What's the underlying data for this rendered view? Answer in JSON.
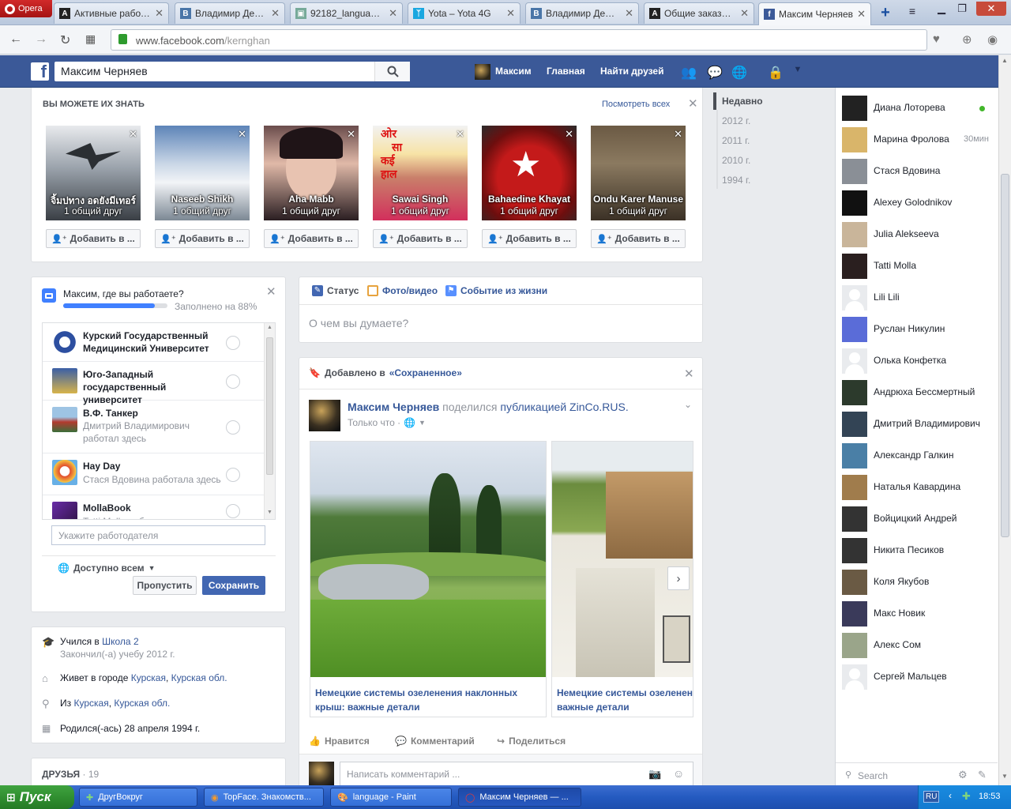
{
  "browser": {
    "opera_label": "Opera",
    "tabs": [
      {
        "title": "Активные работы",
        "favicon": "A",
        "color": "#222"
      },
      {
        "title": "Владимир Демченко",
        "favicon": "B",
        "color": "#4a76a8"
      },
      {
        "title": "92182_language - S",
        "favicon": "▣",
        "color": "#7a9"
      },
      {
        "title": "Yota – Yota 4G",
        "favicon": "ᛉ",
        "color": "#19a7e0"
      },
      {
        "title": "Владимир Демченко",
        "favicon": "B",
        "color": "#4a76a8"
      },
      {
        "title": "Общие заказы Пер",
        "favicon": "A",
        "color": "#222"
      },
      {
        "title": "Максим Черняев",
        "favicon": "f",
        "color": "#3b5998"
      }
    ],
    "url_domain": "www.facebook.com",
    "url_path": "/kernghan"
  },
  "header": {
    "search_value": "Максим Черняев",
    "user_name": "Максим",
    "home": "Главная",
    "find_friends": "Найти друзей"
  },
  "pymk": {
    "title": "ВЫ МОЖЕТЕ ИХ ЗНАТЬ",
    "see_all": "Посмотреть всех",
    "people": [
      {
        "name": "จิ้มปทาง อดยังมีเทอร์",
        "mutual": "1 общий друг",
        "add": "Добавить в ..."
      },
      {
        "name": "Naseeb Shikh",
        "mutual": "1 общий друг",
        "add": "Добавить в ..."
      },
      {
        "name": "Aha Mabb",
        "mutual": "1 общий друг",
        "add": "Добавить в ..."
      },
      {
        "name": "Sawai Singh",
        "mutual": "1 общий друг",
        "add": "Добавить в ..."
      },
      {
        "name": "Bahaedine Khayat",
        "mutual": "1 общий друг",
        "add": "Добавить в ..."
      },
      {
        "name": "Ondu Karer Manuse",
        "mutual": "1 общий друг",
        "add": "Добавить в ..."
      }
    ],
    "poster_text": [
      "ओर",
      "सा",
      "कई",
      "हाल"
    ]
  },
  "timeline": {
    "items": [
      "Недавно",
      "2012 г.",
      "2011 г.",
      "2010 г.",
      "1994 г."
    ]
  },
  "work": {
    "question": "Максим, где вы работаете?",
    "progress_label": "Заполнено на 88%",
    "progress_value": 0.88,
    "list": [
      {
        "title": "Курский Государственный Медицинский Университет",
        "sub": ""
      },
      {
        "title": "Юго-Западный государственный университет",
        "sub": ""
      },
      {
        "title": "В.Ф. Танкер",
        "sub": "Дмитрий Владимирович работал здесь"
      },
      {
        "title": "Hay Day",
        "sub": "Стася Вдовина работала здесь"
      },
      {
        "title": "MollaBook",
        "sub": "Tatti Molla работала здесь"
      }
    ],
    "input_placeholder": "Укажите работодателя",
    "privacy": "Доступно всем",
    "skip": "Пропустить",
    "save": "Сохранить"
  },
  "about": {
    "studied_prefix": "Учился в",
    "studied_link": "Школа 2",
    "studied_sub": "Закончил(-а) учебу 2012 г.",
    "lives_prefix": "Живет в городе",
    "lives_city": "Курская",
    "lives_region": "Курская обл.",
    "from_prefix": "Из",
    "from_city": "Курская",
    "from_region": "Курская обл.",
    "born": "Родился(-ась) 28 апреля 1994 г.",
    "comma": ","
  },
  "friends": {
    "label": "ДРУЗЬЯ",
    "count": "· 19"
  },
  "composer": {
    "status": "Статус",
    "photo": "Фото/видео",
    "life_event": "Событие из жизни",
    "placeholder": "О чем вы думаете?"
  },
  "post": {
    "saved_prefix": "Добавлено в",
    "saved_link": "«Сохраненное»",
    "author": "Максим Черняев",
    "action": "поделился",
    "publication": "публикацией",
    "page": "ZinCo.RUS.",
    "time": "Только что ·",
    "links": [
      {
        "title": "Немецкие системы озеленения наклонных крыш: важные детали"
      },
      {
        "title": "Немецкие системы озеленения наклонных крыш: важные детали"
      }
    ],
    "like": "Нравится",
    "comment": "Комментарий",
    "share": "Поделиться",
    "comment_placeholder": "Написать комментарий ..."
  },
  "chat": {
    "contacts": [
      {
        "name": "Диана Лоторева",
        "status": "online"
      },
      {
        "name": "Марина Фролова",
        "status": "30мин"
      },
      {
        "name": "Стася Вдовина",
        "status": ""
      },
      {
        "name": "Alexey Golodnikov",
        "status": ""
      },
      {
        "name": "Julia Alekseeva",
        "status": ""
      },
      {
        "name": "Tatti Molla",
        "status": ""
      },
      {
        "name": "Lili Lili",
        "status": ""
      },
      {
        "name": "Руслан Никулин",
        "status": ""
      },
      {
        "name": "Олька Конфетка",
        "status": ""
      },
      {
        "name": "Андрюха Бессмертный",
        "status": ""
      },
      {
        "name": "Дмитрий Владимирович",
        "status": ""
      },
      {
        "name": "Александр Галкин",
        "status": ""
      },
      {
        "name": "Наталья Кавардина",
        "status": ""
      },
      {
        "name": "Войцицкий Андрей",
        "status": ""
      },
      {
        "name": "Никита Песиков",
        "status": ""
      },
      {
        "name": "Коля Якубов",
        "status": ""
      },
      {
        "name": "Макс Новик",
        "status": ""
      },
      {
        "name": "Алекс Сом",
        "status": ""
      },
      {
        "name": "Сергей Мальцев",
        "status": ""
      }
    ],
    "search_placeholder": "Search"
  },
  "taskbar": {
    "start": "Пуск",
    "items": [
      {
        "label": "ДругВокруг"
      },
      {
        "label": "TopFace. Знакомств..."
      },
      {
        "label": "language - Paint"
      },
      {
        "label": "Максим Черняев — ..."
      }
    ],
    "lang": "RU",
    "time": "18:53"
  },
  "colors": {
    "fb_blue": "#3b5998",
    "link": "#365899",
    "online": "#42b72a"
  }
}
